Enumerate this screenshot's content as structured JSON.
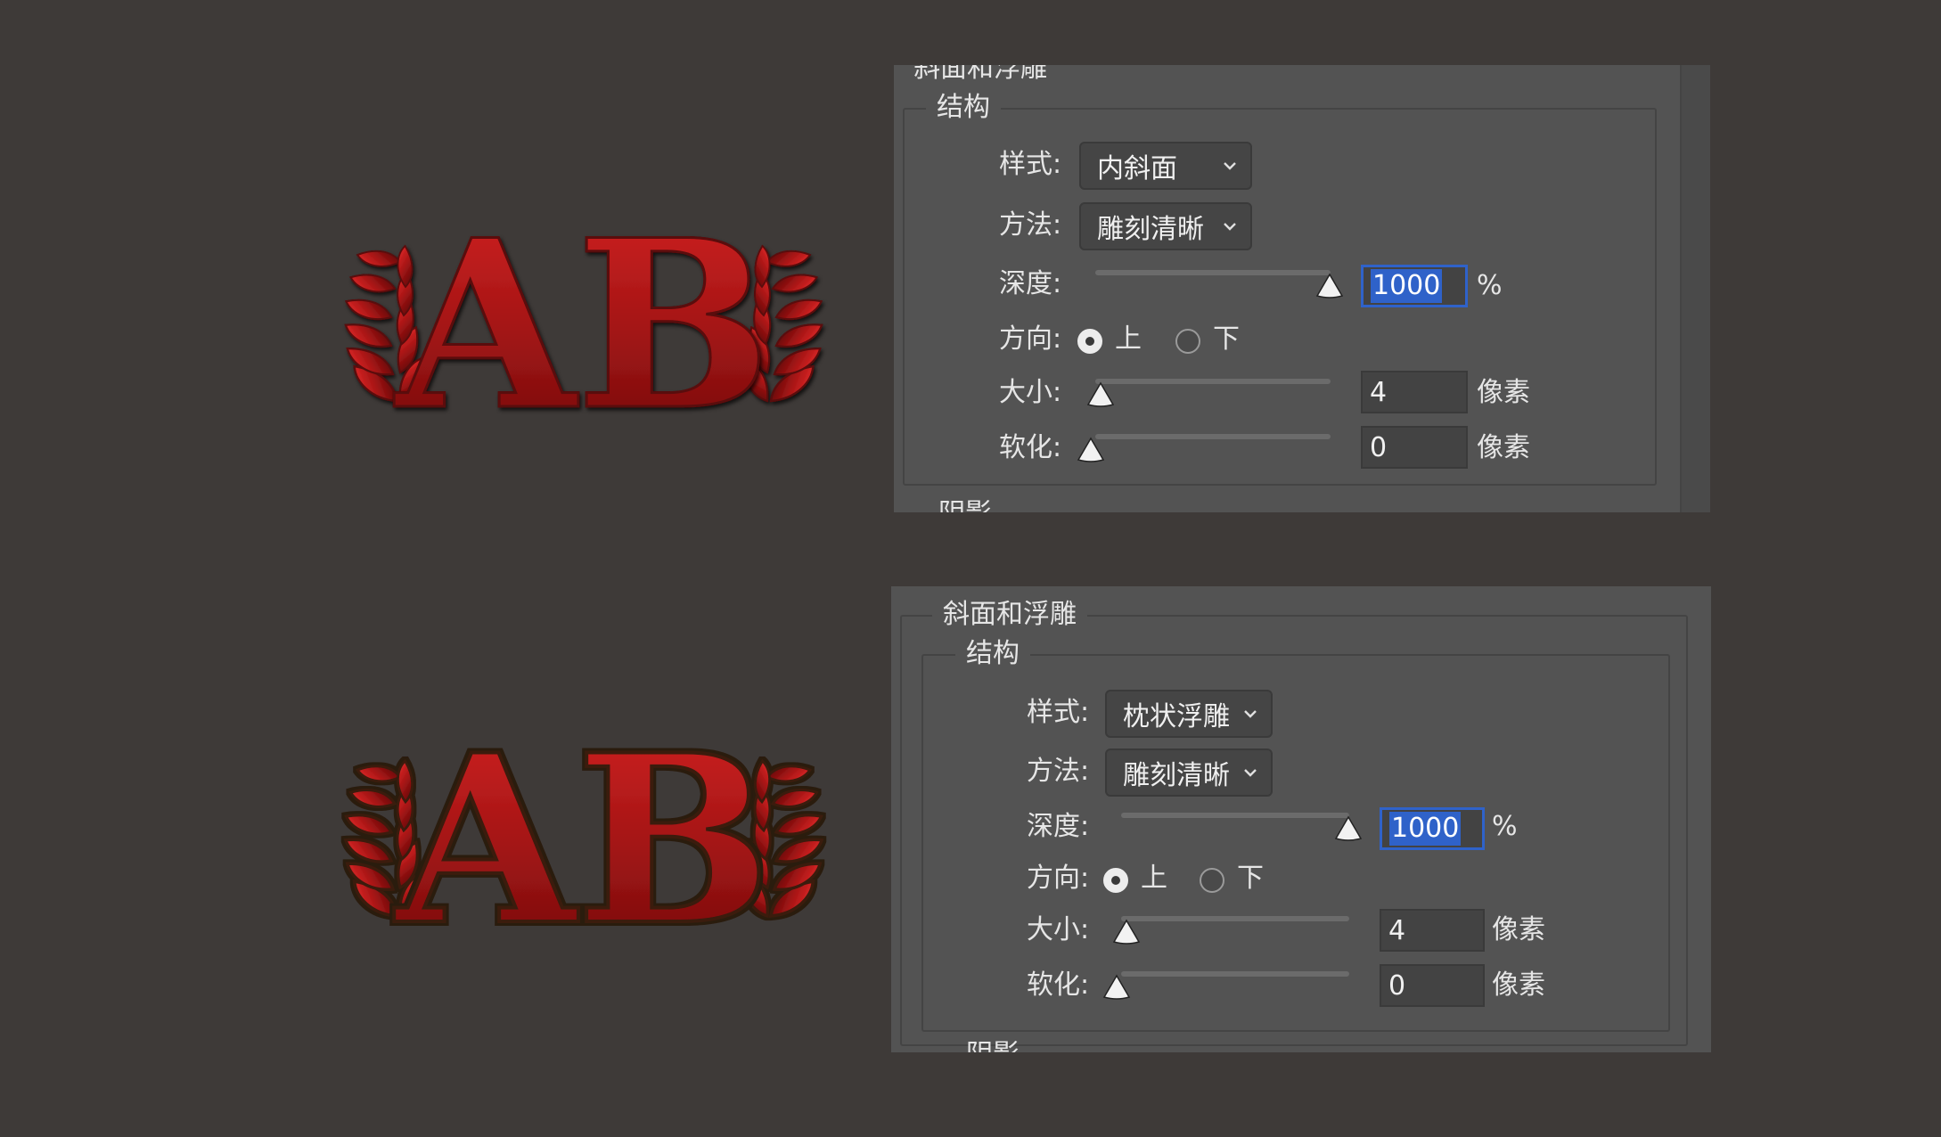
{
  "colors": {
    "background": "#3e3a38",
    "panel": "#535353",
    "accent": "#2f62c9",
    "logo_red": "#b51a1a"
  },
  "logos": [
    {
      "text": "AB",
      "style": "inner-bevel"
    },
    {
      "text": "AB",
      "style": "pillow-emboss"
    }
  ],
  "panels": [
    {
      "header": "斜面和浮雕",
      "group": "结构",
      "rows": {
        "style": {
          "label": "样式:",
          "value": "内斜面"
        },
        "technique": {
          "label": "方法:",
          "value": "雕刻清晰"
        },
        "depth": {
          "label": "深度:",
          "value": "1000",
          "unit": "%",
          "slider": 1.0
        },
        "direction": {
          "label": "方向:",
          "up": "上",
          "down": "下",
          "selected": "上"
        },
        "size": {
          "label": "大小:",
          "value": "4",
          "unit": "像素",
          "slider": 0.02
        },
        "soften": {
          "label": "软化:",
          "value": "0",
          "unit": "像素",
          "slider": 0.0
        }
      },
      "next_section": "阴影"
    },
    {
      "header": "斜面和浮雕",
      "group": "结构",
      "rows": {
        "style": {
          "label": "样式:",
          "value": "枕状浮雕"
        },
        "technique": {
          "label": "方法:",
          "value": "雕刻清晰"
        },
        "depth": {
          "label": "深度:",
          "value": "1000",
          "unit": "%",
          "slider": 1.0
        },
        "direction": {
          "label": "方向:",
          "up": "上",
          "down": "下",
          "selected": "上"
        },
        "size": {
          "label": "大小:",
          "value": "4",
          "unit": "像素",
          "slider": 0.02
        },
        "soften": {
          "label": "软化:",
          "value": "0",
          "unit": "像素",
          "slider": 0.0
        }
      },
      "next_section": "阴影"
    }
  ]
}
